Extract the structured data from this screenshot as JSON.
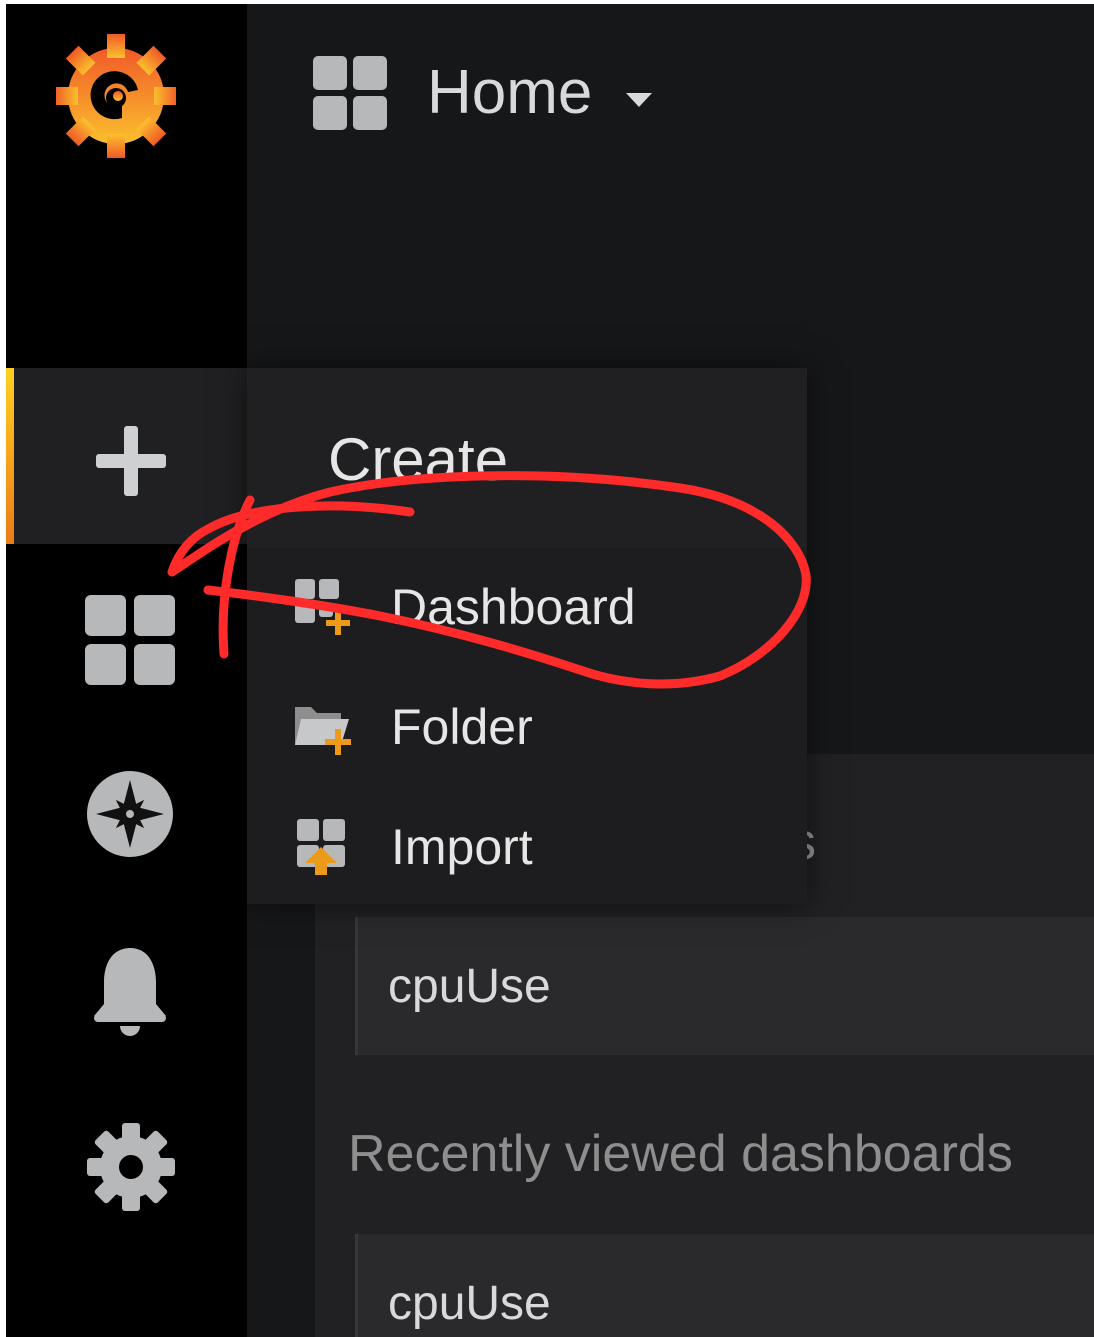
{
  "header": {
    "title": "Home",
    "dropdown_icon": "caret-down-icon",
    "dashboard_icon": "apps-grid-icon"
  },
  "sidebar": {
    "logo_icon": "grafana-logo-icon",
    "items": [
      {
        "id": "create",
        "icon": "plus-icon",
        "active": true
      },
      {
        "id": "dashboards",
        "icon": "apps-grid-icon"
      },
      {
        "id": "explore",
        "icon": "compass-icon"
      },
      {
        "id": "alerting",
        "icon": "bell-icon"
      },
      {
        "id": "configuration",
        "icon": "gear-icon"
      }
    ]
  },
  "create_menu": {
    "title": "Create",
    "items": [
      {
        "label": "Dashboard",
        "icon": "dashboard-add-icon"
      },
      {
        "label": "Folder",
        "icon": "folder-add-icon"
      },
      {
        "label": "Import",
        "icon": "import-icon"
      }
    ]
  },
  "home": {
    "starred_header_fragment": "s",
    "starred": [
      {
        "name": "cpuUse"
      }
    ],
    "recent_header": "Recently viewed dashboards",
    "recent": [
      {
        "name": "cpuUse"
      }
    ]
  },
  "colors": {
    "brand_orange": "#f46800",
    "brand_yellow": "#fbc02d",
    "annotation_red": "#ff2a2a",
    "active_bar": "#eb7b18",
    "sidebar_bg": "#000000",
    "page_bg": "#161719"
  }
}
